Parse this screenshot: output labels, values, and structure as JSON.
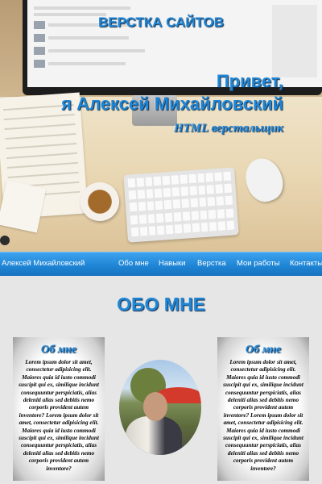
{
  "hero": {
    "title": "ВЕРСТКА САЙТОВ",
    "greeting_line1": "Привет,",
    "greeting_line2": "я Алексей Михайловский",
    "role": "HTML верстальщик"
  },
  "nav": {
    "brand": "Алексей Михайловский",
    "items": [
      "Обо мне",
      "Навыки",
      "Верстка",
      "Мои работы",
      "Контакты"
    ]
  },
  "about": {
    "title": "ОБО МНЕ",
    "cards": [
      {
        "heading": "Об мне",
        "text": "Lorem ipsum dolor sit amet, consectetur adipisicing elit. Maiores quia id iusto commodi suscipit qui ex, similique incidunt consequuntur perspiciatis, alias deleniti alias sed debitis nemo corporis provident autem inventore? Lorem ipsum dolor sit amet, consectetur adipisicing elit. Maiores quia id iusto commodi suscipit qui ex, similique incidunt consequuntur perspiciatis, alias deleniti alias sed debitis nemo corporis provident autem inventore?"
      },
      {
        "heading": "Об мне",
        "text": "Lorem ipsum dolor sit amet, consectetur adipisicing elit. Maiores quia id iusto commodi suscipit qui ex, similique incidunt consequuntur perspiciatis, alias deleniti alias sed debitis nemo corporis provident autem inventore? Lorem ipsum dolor sit amet, consectetur adipisicing elit. Maiores quia id iusto commodi suscipit qui ex, similique incidunt consequuntur perspiciatis, alias deleniti alias sed debitis nemo corporis provident autem inventore?"
      }
    ]
  },
  "colors": {
    "accent": "#1f86d6",
    "nav_bg": "#2a90e0",
    "page_bg": "#e6e6e6"
  }
}
